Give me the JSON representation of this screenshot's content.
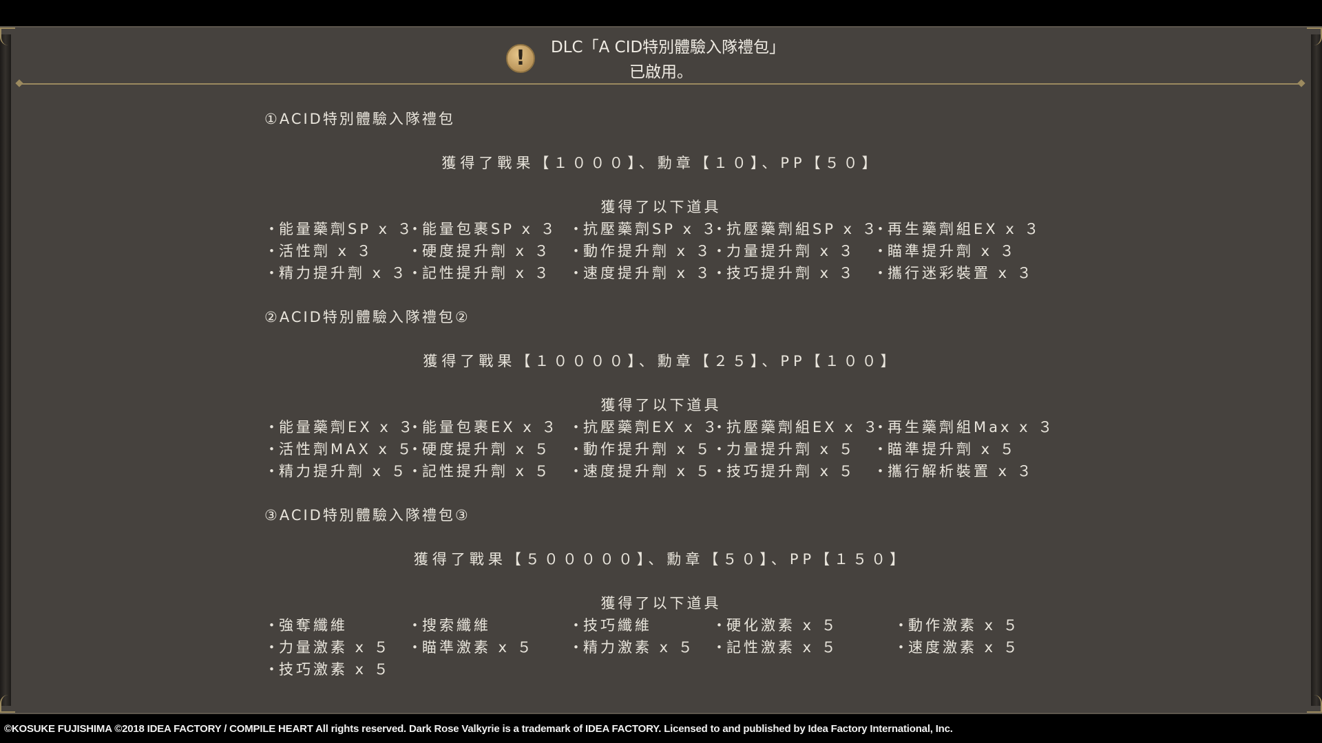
{
  "dialog": {
    "title_line1": "DLC「A CID特別體驗入隊禮包」",
    "title_line2": "已啟用。"
  },
  "packs": [
    {
      "title": "①ACID特別體驗入隊禮包",
      "rewards": "獲得了戰果【１０００】、勳章【１０】、PP【５０】",
      "items_heading": "獲得了以下道具",
      "items": [
        "能量藥劑SP x ３",
        "能量包裹SP x ３",
        "抗壓藥劑SP x ３",
        "抗壓藥劑組SP x ３",
        "再生藥劑組EX x ３",
        "活性劑 x ３",
        "硬度提升劑 x ３",
        "動作提升劑 x ３",
        "力量提升劑 x ３",
        "瞄準提升劑 x ３",
        "精力提升劑 x ３",
        "記性提升劑 x ３",
        "速度提升劑 x ３",
        "技巧提升劑 x ３",
        "攜行迷彩裝置 x ３"
      ]
    },
    {
      "title": "②ACID特別體驗入隊禮包②",
      "rewards": "獲得了戰果【１００００】、勳章【２５】、PP【１００】",
      "items_heading": "獲得了以下道具",
      "items": [
        "能量藥劑EX x ３",
        "能量包裹EX x ３",
        "抗壓藥劑EX x ３",
        "抗壓藥劑組EX x ３",
        "再生藥劑組Max x ３",
        "活性劑MAX x ５",
        "硬度提升劑 x ５",
        "動作提升劑 x ５",
        "力量提升劑 x ５",
        "瞄準提升劑 x ５",
        "精力提升劑 x ５",
        "記性提升劑 x ５",
        "速度提升劑 x ５",
        "技巧提升劑 x ５",
        "攜行解析裝置 x ３"
      ]
    },
    {
      "title": "③ACID特別體驗入隊禮包③",
      "rewards": "獲得了戰果【５０００００】、勳章【５０】、PP【１５０】",
      "items_heading": "獲得了以下道具",
      "items": [
        "強奪纖維",
        "搜索纖維",
        "技巧纖維",
        "硬化激素 x ５",
        "動作激素 x ５",
        "力量激素 x ５",
        "瞄準激素 x ５",
        "精力激素 x ５",
        "記性激素 x ５",
        "速度激素 x ５",
        "技巧激素 x ５"
      ]
    }
  ],
  "footer": {
    "copyright": "©KOSUKE FUJISHIMA ©2018 IDEA FACTORY / COMPILE HEART All rights reserved. Dark Rose Valkyrie is a trademark of IDEA FACTORY. Licensed to and published by Idea Factory International, Inc."
  },
  "icons": {
    "alert": "exclamation-icon"
  },
  "colors": {
    "panel": "#46423e",
    "gold": "#9c8a5f",
    "text": "#e9e5dc"
  }
}
